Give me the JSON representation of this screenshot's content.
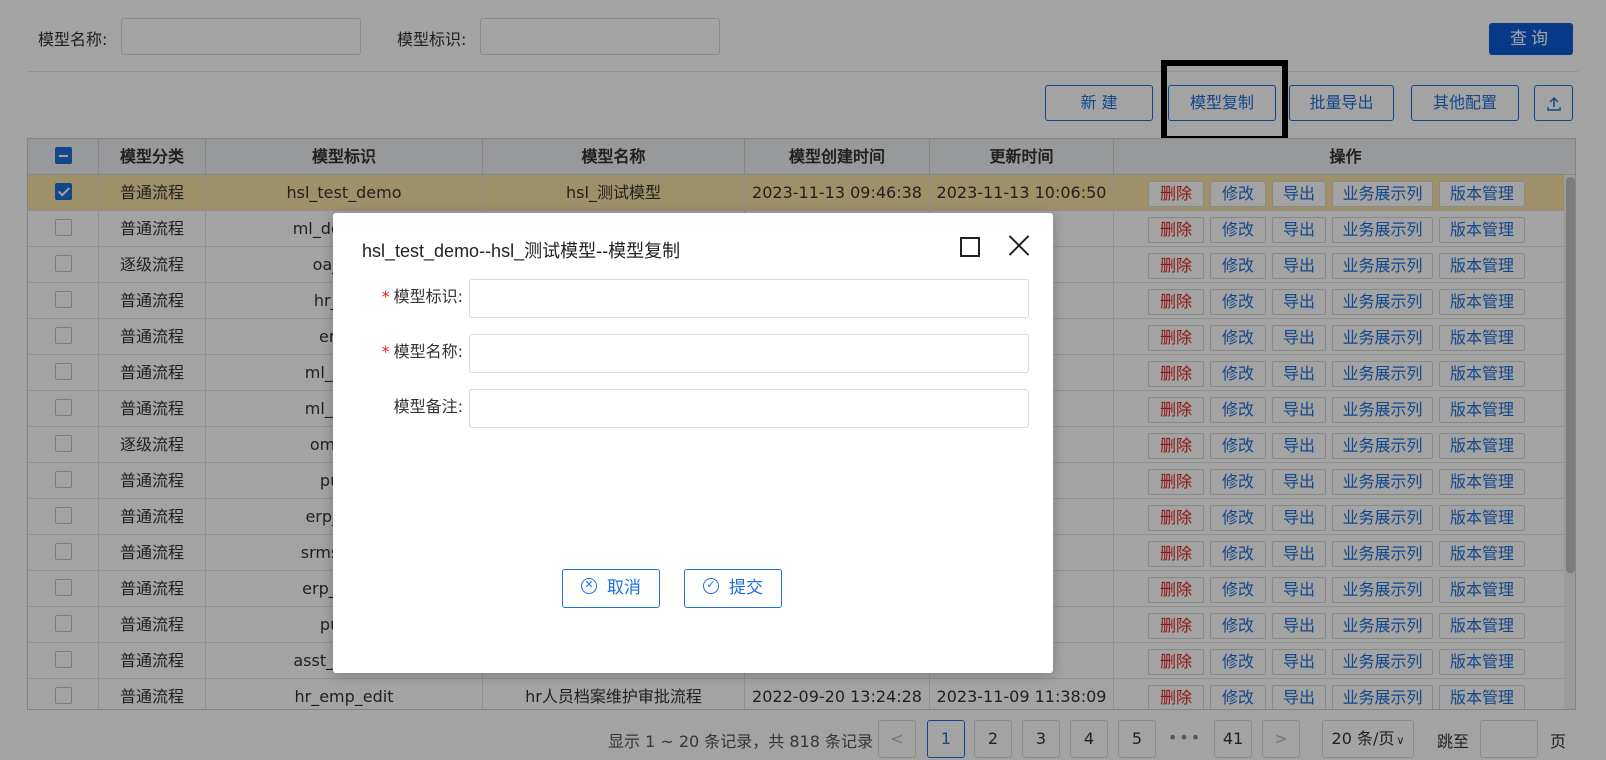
{
  "search": {
    "name_label": "模型名称:",
    "name_value": "",
    "id_label": "模型标识:",
    "id_value": "",
    "query_button": "查询"
  },
  "toolbar": {
    "new_button": "新 建",
    "copy_button": "模型复制",
    "export_button": "批量导出",
    "config_button": "其他配置",
    "upload_icon": "upload-icon"
  },
  "table": {
    "columns": [
      "模型分类",
      "模型标识",
      "模型名称",
      "模型创建时间",
      "更新时间",
      "操作"
    ],
    "ops": [
      "删除",
      "修改",
      "导出",
      "业务展示列",
      "版本管理"
    ],
    "rows": [
      {
        "checked": true,
        "cat": "普通流程",
        "id": "hsl_test_demo",
        "name": "hsl_测试模型",
        "created": "2023-11-13 09:46:38",
        "updated": "2023-11-13 10:06:50"
      },
      {
        "checked": false,
        "cat": "普通流程",
        "id": "ml_dept_app",
        "name": "",
        "created": "",
        "updated": ":56:57"
      },
      {
        "checked": false,
        "cat": "逐级流程",
        "id": "oa_mee",
        "name": "",
        "created": "",
        "updated": ":28:54"
      },
      {
        "checked": false,
        "cat": "普通流程",
        "id": "hr_emp",
        "name": "",
        "created": "",
        "updated": ":58:09"
      },
      {
        "checked": false,
        "cat": "普通流程",
        "id": "erp_cr",
        "name": "",
        "created": "",
        "updated": ":29:40"
      },
      {
        "checked": false,
        "cat": "普通流程",
        "id": "ml_stock_",
        "name": "",
        "created": "",
        "updated": ":39:38"
      },
      {
        "checked": false,
        "cat": "普通流程",
        "id": "ml_stock_",
        "name": "",
        "created": "",
        "updated": ":38:39"
      },
      {
        "checked": false,
        "cat": "逐级流程",
        "id": "om_cont",
        "name": "",
        "created": "",
        "updated": ":41:33"
      },
      {
        "checked": false,
        "cat": "普通流程",
        "id": "public",
        "name": "",
        "created": "",
        "updated": ":11:50"
      },
      {
        "checked": false,
        "cat": "普通流程",
        "id": "erp_pm_c",
        "name": "",
        "created": "",
        "updated": ":36:34"
      },
      {
        "checked": false,
        "cat": "普通流程",
        "id": "srms_pape",
        "name": "",
        "created": "",
        "updated": ":46:44"
      },
      {
        "checked": false,
        "cat": "普通流程",
        "id": "erp_pm_cr",
        "name": "",
        "created": "",
        "updated": ":12:05"
      },
      {
        "checked": false,
        "cat": "普通流程",
        "id": "public",
        "name": "",
        "created": "",
        "updated": ":18:24"
      },
      {
        "checked": false,
        "cat": "普通流程",
        "id": "asst_maintai",
        "name": "",
        "created": "",
        "updated": ":48:55"
      },
      {
        "checked": false,
        "cat": "普通流程",
        "id": "hr_emp_edit",
        "name": "hr人员档案维护审批流程",
        "created": "2022-09-20 13:24:28",
        "updated": "2023-11-09 11:38:09"
      }
    ]
  },
  "pagination": {
    "info": "显示 1 ~ 20 条记录，共 818 条记录",
    "pages": [
      "1",
      "2",
      "3",
      "4",
      "5"
    ],
    "ellipsis": "•••",
    "last_page": "41",
    "prev": "<",
    "next": ">",
    "page_size": "20 条/页",
    "jump_label": "跳至",
    "jump_suffix": "页"
  },
  "modal": {
    "title": "hsl_test_demo--hsl_测试模型--模型复制",
    "field_id_label": "模型标识:",
    "field_name_label": "模型名称:",
    "field_remark_label": "模型备注:",
    "required_mark": "*",
    "cancel_button": "取消",
    "submit_button": "提交"
  }
}
